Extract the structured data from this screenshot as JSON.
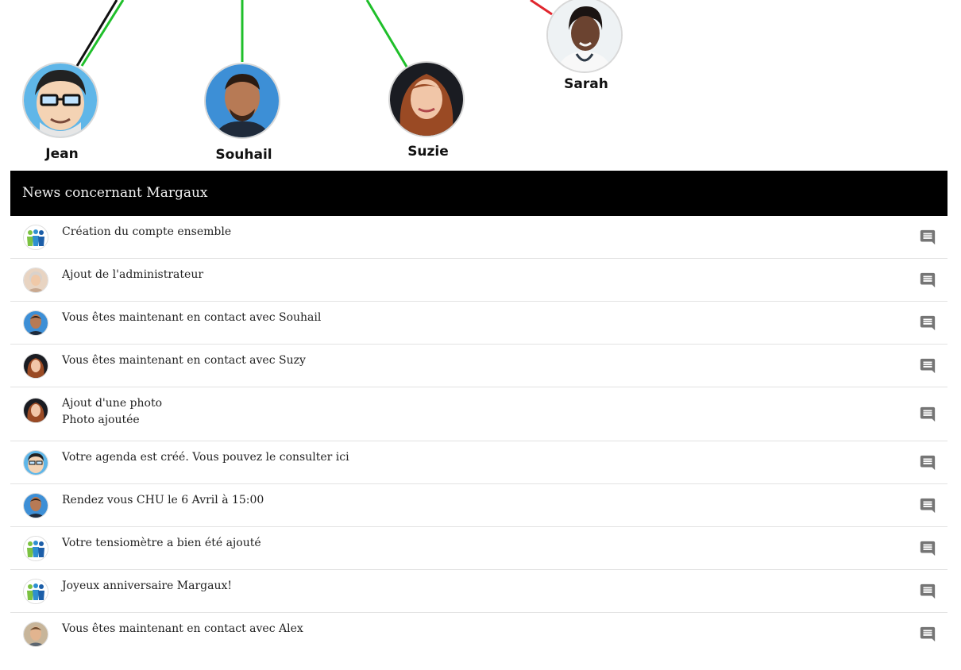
{
  "graph": {
    "contacts": [
      {
        "id": "jean",
        "name": "Jean",
        "avatar": "cartoon-avatar"
      },
      {
        "id": "souhail",
        "name": "Souhail",
        "avatar": "man-photo-avatar"
      },
      {
        "id": "suzie",
        "name": "Suzie",
        "avatar": "woman-redhair-avatar"
      },
      {
        "id": "sarah",
        "name": "Sarah",
        "avatar": "doctor-avatar"
      }
    ],
    "link_colors": {
      "green": "#1fbf2a",
      "black": "#111111",
      "red": "#e0262e"
    }
  },
  "news": {
    "title": "News concernant Margaux",
    "items": [
      {
        "text": "Création du compte ensemble",
        "avatar": "family-logo-icon"
      },
      {
        "text": "Ajout de l'administrateur",
        "avatar": "elder-woman-avatar"
      },
      {
        "text": "Vous êtes maintenant en contact avec Souhail",
        "avatar": "man-photo-avatar"
      },
      {
        "text": "Vous êtes maintenant en contact avec Suzy",
        "avatar": "woman-redhair-avatar"
      },
      {
        "text": "Ajout d'une photo",
        "subtext": "Photo ajoutée",
        "avatar": "woman-redhair-avatar"
      },
      {
        "text": "Votre agenda est créé. Vous pouvez le consulter ici",
        "avatar": "cartoon-avatar"
      },
      {
        "text": "Rendez vous CHU le 6 Avril à 15:00",
        "avatar": "man-photo-avatar"
      },
      {
        "text": "Votre tensiomètre a bien été ajouté",
        "avatar": "family-logo-icon"
      },
      {
        "text": "Joyeux anniversaire Margaux!",
        "avatar": "family-logo-icon"
      },
      {
        "text": "Vous êtes maintenant en contact avec Alex",
        "avatar": "young-man-avatar"
      }
    ],
    "comment_icon": "comment-icon",
    "comment_color": "#757575"
  }
}
